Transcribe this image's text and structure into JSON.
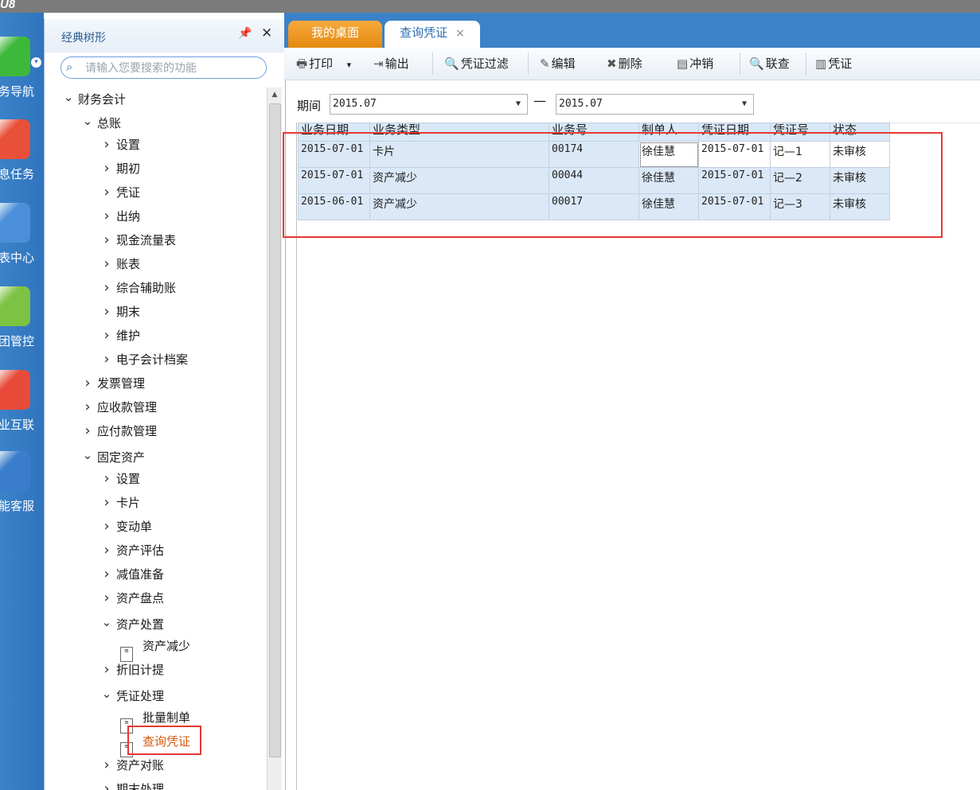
{
  "app": {
    "logo": "U8"
  },
  "nav_strip": {
    "items": [
      {
        "label": "务导航",
        "icon": "business-nav-icon",
        "color": "#3db83a"
      },
      {
        "label": "息任务",
        "icon": "message-task-icon",
        "color": "#e8503a"
      },
      {
        "label": "表中心",
        "icon": "report-center-icon",
        "color": "#4a8fd8"
      },
      {
        "label": "团管控",
        "icon": "group-control-icon",
        "color": "#7cc243"
      },
      {
        "label": "业互联",
        "icon": "enterprise-link-icon",
        "color": "#e84b3a"
      },
      {
        "label": "能客服",
        "icon": "smart-service-icon",
        "color": "#3a7ecb"
      }
    ]
  },
  "tree_panel": {
    "title": "经典树形",
    "search_placeholder": "请输入您要搜索的功能",
    "items": [
      {
        "label": "财务会计",
        "level": 0,
        "state": "expanded"
      },
      {
        "label": "总账",
        "level": 1,
        "state": "expanded"
      },
      {
        "label": "设置",
        "level": 2,
        "state": "collapsed"
      },
      {
        "label": "期初",
        "level": 2,
        "state": "collapsed"
      },
      {
        "label": "凭证",
        "level": 2,
        "state": "collapsed"
      },
      {
        "label": "出纳",
        "level": 2,
        "state": "collapsed"
      },
      {
        "label": "现金流量表",
        "level": 2,
        "state": "collapsed"
      },
      {
        "label": "账表",
        "level": 2,
        "state": "collapsed"
      },
      {
        "label": "综合辅助账",
        "level": 2,
        "state": "collapsed"
      },
      {
        "label": "期末",
        "level": 2,
        "state": "collapsed"
      },
      {
        "label": "维护",
        "level": 2,
        "state": "collapsed"
      },
      {
        "label": "电子会计档案",
        "level": 2,
        "state": "collapsed"
      },
      {
        "label": "发票管理",
        "level": 1,
        "state": "collapsed"
      },
      {
        "label": "应收款管理",
        "level": 1,
        "state": "collapsed"
      },
      {
        "label": "应付款管理",
        "level": 1,
        "state": "collapsed"
      },
      {
        "label": "固定资产",
        "level": 1,
        "state": "expanded"
      },
      {
        "label": "设置",
        "level": 2,
        "state": "collapsed"
      },
      {
        "label": "卡片",
        "level": 2,
        "state": "collapsed"
      },
      {
        "label": "变动单",
        "level": 2,
        "state": "collapsed"
      },
      {
        "label": "资产评估",
        "level": 2,
        "state": "collapsed"
      },
      {
        "label": "减值准备",
        "level": 2,
        "state": "collapsed"
      },
      {
        "label": "资产盘点",
        "level": 2,
        "state": "collapsed"
      },
      {
        "label": "资产处置",
        "level": 2,
        "state": "expanded"
      },
      {
        "label": "资产减少",
        "level": 3,
        "state": "leaf"
      },
      {
        "label": "折旧计提",
        "level": 2,
        "state": "collapsed"
      },
      {
        "label": "凭证处理",
        "level": 2,
        "state": "expanded"
      },
      {
        "label": "批量制单",
        "level": 3,
        "state": "leaf"
      },
      {
        "label": "查询凭证",
        "level": 3,
        "state": "leaf",
        "selected": true
      },
      {
        "label": "资产对账",
        "level": 2,
        "state": "collapsed"
      },
      {
        "label": "期末处理",
        "level": 2,
        "state": "collapsed"
      }
    ]
  },
  "tabs": [
    {
      "label": "我的桌面",
      "active": false
    },
    {
      "label": "查询凭证",
      "active": true,
      "close": "×"
    }
  ],
  "toolbar": [
    {
      "label": "打印",
      "icon": "print-icon",
      "glyph": "🖶",
      "dropdown": true
    },
    {
      "label": "输出",
      "icon": "export-icon",
      "glyph": "⇥"
    },
    {
      "label": "凭证过滤",
      "icon": "filter-icon",
      "glyph": "🔍"
    },
    {
      "label": "编辑",
      "icon": "edit-pencil-icon",
      "glyph": "✎"
    },
    {
      "label": "删除",
      "icon": "delete-icon",
      "glyph": "✖"
    },
    {
      "label": "冲销",
      "icon": "reverse-icon",
      "glyph": "▤"
    },
    {
      "label": "联查",
      "icon": "link-query-icon",
      "glyph": "🔍"
    },
    {
      "label": "凭证",
      "icon": "voucher-icon",
      "glyph": "▥"
    }
  ],
  "filter": {
    "period_label": "期间",
    "from": "2015.07",
    "separator": "—",
    "to": "2015.07"
  },
  "grid": {
    "columns": [
      "业务日期",
      "业务类型",
      "业务号",
      "制单人",
      "凭证日期",
      "凭证号",
      "状态"
    ],
    "rows": [
      [
        "2015-07-01",
        "卡片",
        "00174",
        "徐佳慧",
        "2015-07-01",
        "记—1",
        "未审核"
      ],
      [
        "2015-07-01",
        "资产减少",
        "00044",
        "徐佳慧",
        "2015-07-01",
        "记—2",
        "未审核"
      ],
      [
        "2015-06-01",
        "资产减少",
        "00017",
        "徐佳慧",
        "2015-07-01",
        "记—3",
        "未审核"
      ]
    ]
  },
  "colors": {
    "nav_blue": "#3b82c8",
    "tab_orange": "#f0a030",
    "highlight_red": "#e53935",
    "row_blue": "#dbe8f7"
  }
}
